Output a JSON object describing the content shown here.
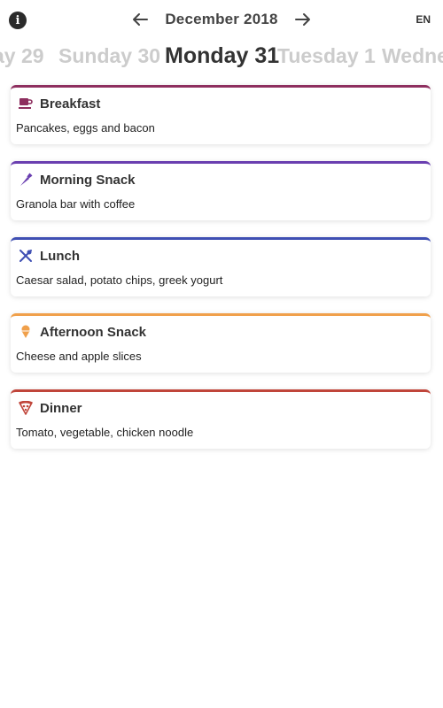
{
  "header": {
    "info_icon": "info-icon",
    "prev_icon": "arrow-left-icon",
    "next_icon": "arrow-right-icon",
    "month": "December 2018",
    "language": "EN"
  },
  "days": [
    {
      "label": "ay 29",
      "active": false
    },
    {
      "label": "Sunday 30",
      "active": false
    },
    {
      "label": "Monday 31",
      "active": true
    },
    {
      "label": "Tuesday 1",
      "active": false
    },
    {
      "label": "Wednes",
      "active": false
    }
  ],
  "meals": [
    {
      "title": "Breakfast",
      "description": "Pancakes, eggs and bacon",
      "color": "#8e2f5f",
      "icon": "coffee-cup-icon"
    },
    {
      "title": "Morning Snack",
      "description": "Granola bar with coffee",
      "color": "#6a3fb0",
      "icon": "carrot-icon"
    },
    {
      "title": "Lunch",
      "description": "Caesar salad, potato chips, greek yogurt",
      "color": "#3f4fb3",
      "icon": "utensils-icon"
    },
    {
      "title": "Afternoon Snack",
      "description": "Cheese and apple slices",
      "color": "#f0a04b",
      "icon": "ice-cream-icon"
    },
    {
      "title": "Dinner",
      "description": "Tomato, vegetable, chicken noodle",
      "color": "#c0453a",
      "icon": "pizza-icon"
    }
  ]
}
